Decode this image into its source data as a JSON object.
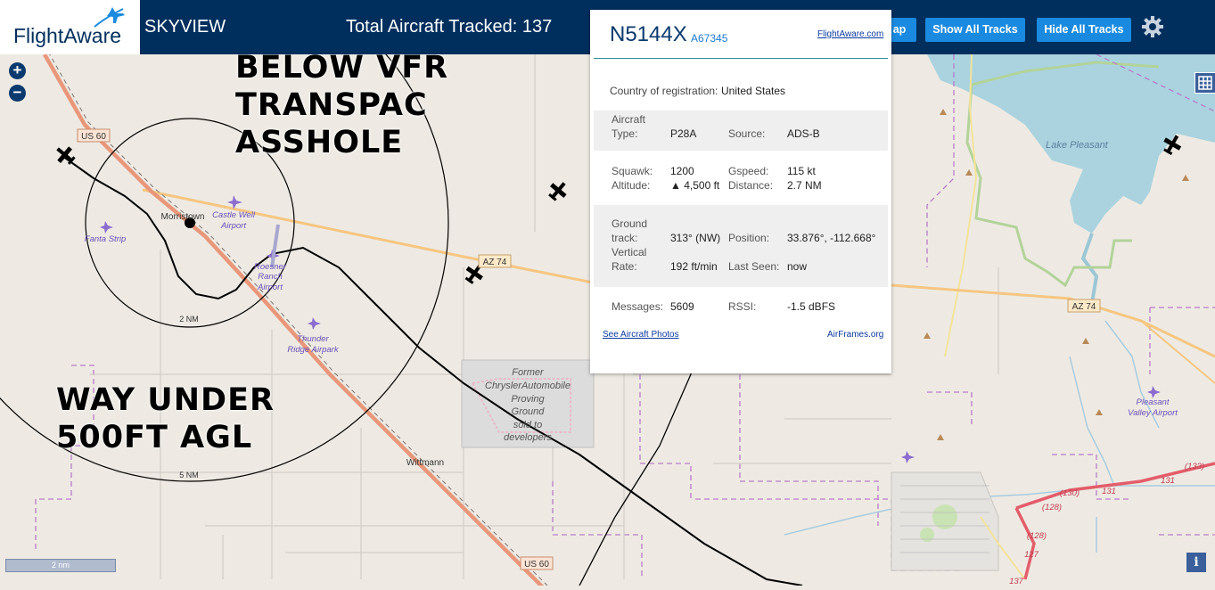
{
  "header": {
    "logo_text": "FlightAware",
    "app_name": "SKYVIEW",
    "tracked_label": "Total Aircraft Tracked: 137",
    "map_button_fragment": "ap",
    "show_tracks_label": "Show All Tracks",
    "hide_tracks_label": "Hide All Tracks",
    "settings_icon": "gear-icon"
  },
  "map_controls": {
    "zoom_in": "+",
    "zoom_out": "−",
    "scale_label": "2 nm",
    "info_label": "i",
    "layers_icon": "grid-icon"
  },
  "annotations": {
    "top_line1": "BELOW VFR",
    "top_line2": "TRANSPAC",
    "top_line3": "ASSHOLE",
    "bottom_line1": "WAY UNDER",
    "bottom_line2": "500FT AGL"
  },
  "map_labels": {
    "us60_top": "US 60",
    "us60_bottom": "US 60",
    "az74_left": "AZ 74",
    "az74_right": "AZ 74",
    "morristown": "Morristown",
    "castle_well_1": "Castle Well",
    "castle_well_2": "Airport",
    "forepaugh": "Fanta Strip",
    "roesner_1": "Roesner",
    "roesner_2": "Ranch",
    "roesner_3": "Airport",
    "thunder_1": "Thunder",
    "thunder_2": "Ridge Airpark",
    "ring_inner": "2 NM",
    "ring_outer": "5 NM",
    "wittmann": "Wittmann",
    "chrysler_1": "Former",
    "chrysler_2": "ChryslerAutomobile",
    "chrysler_3": "Proving",
    "chrysler_4": "Ground",
    "chrysler_5": "sold to",
    "chrysler_6": "developers",
    "lake": "Lake Pleasant",
    "pleasant_valley_1": "Pleasant",
    "pleasant_valley_2": "Valley Airport",
    "r130": "(130)",
    "r131": "131",
    "r131b": "131",
    "r133": "(133)",
    "r128a": "(128)",
    "r128b": "(128)",
    "r127": "127",
    "r137": "137"
  },
  "popup": {
    "ident": "N5144X",
    "hex": "A67345",
    "fa_link": "FlightAware.com",
    "country_label": "Country of registration:",
    "country_value": "United States",
    "aircraft_type_label_1": "Aircraft",
    "aircraft_type_label_2": "Type:",
    "aircraft_type_value": "P28A",
    "source_label": "Source:",
    "source_value": "ADS-B",
    "squawk_label": "Squawk:",
    "squawk_value": "1200",
    "gspeed_label": "Gspeed:",
    "gspeed_value": "115 kt",
    "altitude_label": "Altitude:",
    "altitude_value": "▲ 4,500 ft",
    "distance_label": "Distance:",
    "distance_value": "2.7 NM",
    "ground_track_label_1": "Ground",
    "ground_track_label_2": "track:",
    "ground_track_value": "313° (NW)",
    "position_label": "Position:",
    "position_value": "33.876°, -112.668°",
    "vertical_rate_label_1": "Vertical",
    "vertical_rate_label_2": "Rate:",
    "vertical_rate_value": "192 ft/min",
    "last_seen_label": "Last Seen:",
    "last_seen_value": "now",
    "messages_label": "Messages:",
    "messages_value": "5609",
    "rssi_label": "RSSI:",
    "rssi_value": "-1.5 dBFS",
    "photos_link": "See Aircraft Photos",
    "airframes_link": "AirFrames.org"
  }
}
